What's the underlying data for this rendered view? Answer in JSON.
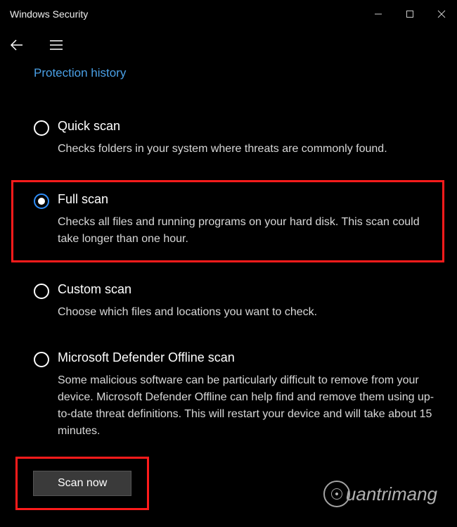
{
  "window": {
    "title": "Windows Security"
  },
  "link": {
    "protection_history": "Protection history"
  },
  "options": [
    {
      "title": "Quick scan",
      "desc": "Checks folders in your system where threats are commonly found.",
      "selected": false,
      "highlighted": false
    },
    {
      "title": "Full scan",
      "desc": "Checks all files and running programs on your hard disk. This scan could take longer than one hour.",
      "selected": true,
      "highlighted": true
    },
    {
      "title": "Custom scan",
      "desc": "Choose which files and locations you want to check.",
      "selected": false,
      "highlighted": false
    },
    {
      "title": "Microsoft Defender Offline scan",
      "desc": "Some malicious software can be particularly difficult to remove from your device. Microsoft Defender Offline can help find and remove them using up-to-date threat definitions. This will restart your device and will take about 15 minutes.",
      "selected": false,
      "highlighted": false
    }
  ],
  "button": {
    "scan_now": "Scan now"
  },
  "watermark": {
    "text": "uantrimang"
  }
}
